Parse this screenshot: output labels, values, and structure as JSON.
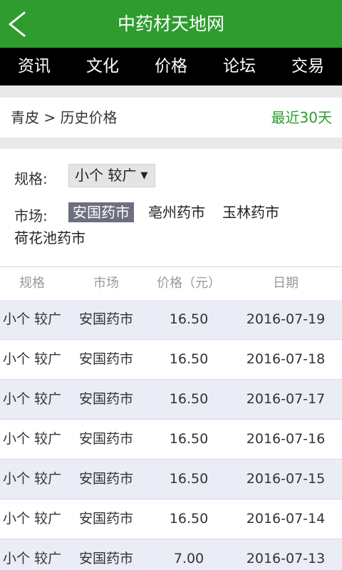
{
  "header": {
    "title": "中药材天地网",
    "back_icon": "chevron-left-icon"
  },
  "nav": {
    "items": [
      "资讯",
      "文化",
      "价格",
      "论坛",
      "交易"
    ]
  },
  "crumb": {
    "text": "青皮 > 历史价格",
    "range_link": "最近30天",
    "accent": "#2e9c2e"
  },
  "filters": {
    "spec_label": "规格:",
    "spec_value": "小个 较广",
    "spec_caret": "▼",
    "market_label": "市场:",
    "markets": [
      "安国药市",
      "亳州药市",
      "玉林药市",
      "荷花池药市"
    ],
    "selected_market": "安国药市"
  },
  "table": {
    "headers": [
      "规格",
      "市场",
      "价格（元）",
      "日期"
    ],
    "rows": [
      [
        "小个 较广",
        "安国药市",
        "16.50",
        "2016-07-19"
      ],
      [
        "小个 较广",
        "安国药市",
        "16.50",
        "2016-07-18"
      ],
      [
        "小个 较广",
        "安国药市",
        "16.50",
        "2016-07-17"
      ],
      [
        "小个 较广",
        "安国药市",
        "16.50",
        "2016-07-16"
      ],
      [
        "小个 较广",
        "安国药市",
        "16.50",
        "2016-07-15"
      ],
      [
        "小个 较广",
        "安国药市",
        "16.50",
        "2016-07-14"
      ],
      [
        "小个 较广",
        "安国药市",
        "7.00",
        "2016-07-13"
      ]
    ]
  }
}
